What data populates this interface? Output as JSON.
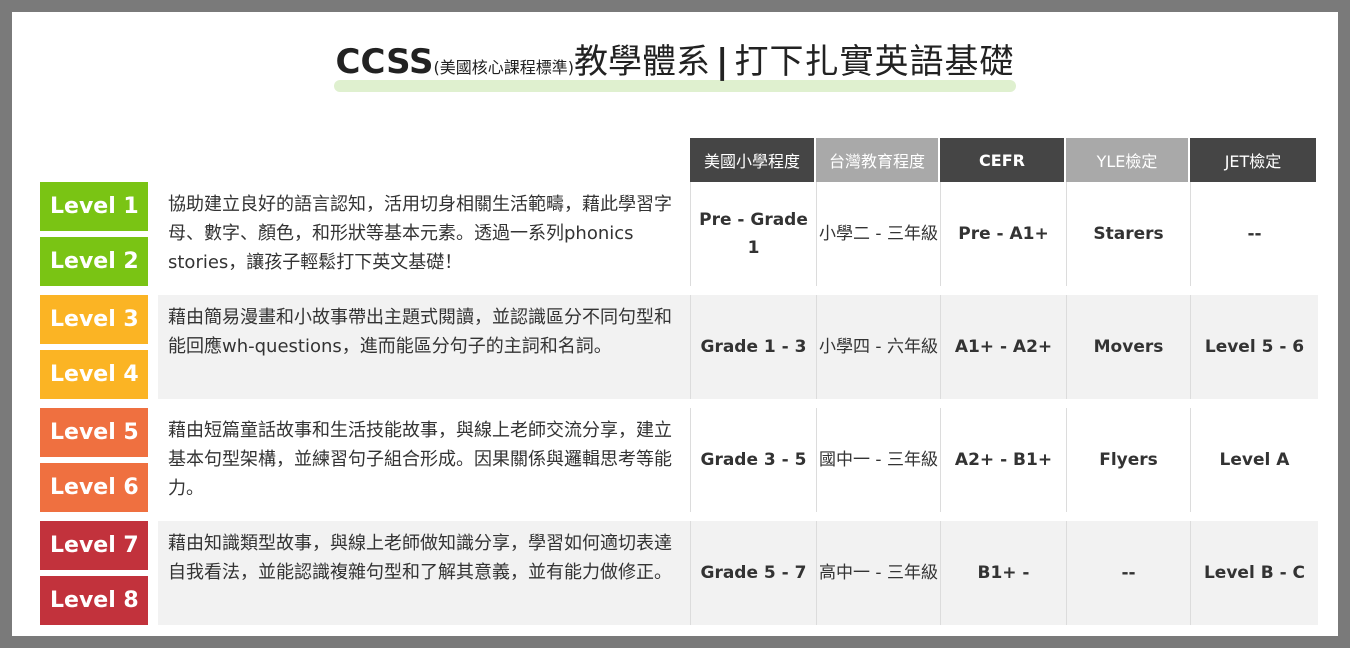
{
  "title": {
    "main": "CCSS",
    "sub": "(美國核心課程標準)",
    "system": "教學體系",
    "bar": "|",
    "tail": "打下扎實英語基礎"
  },
  "headers": [
    "美國小學程度",
    "台灣教育程度",
    "CEFR",
    "YLE檢定",
    "JET檢定"
  ],
  "colors": {
    "l12": "#7ac414",
    "l34": "#fbb424",
    "l56": "#ef7040",
    "l78": "#c2323c",
    "header_dark": "#454545",
    "header_light": "#a9a9a9"
  },
  "rows": [
    {
      "level_a": "Level 1",
      "level_b": "Level 2",
      "desc": "協助建立良好的語言認知，活用切身相關生活範疇，藉此學習字母、數字、顏色，和形狀等基本元素。透過一系列phonics stories，讓孩子輕鬆打下英文基礎！",
      "us": "Pre - Grade 1",
      "tw": "小學二 - 三年級",
      "cefr": "Pre - A1+",
      "yle": "Starers",
      "jet": "--"
    },
    {
      "level_a": "Level 3",
      "level_b": "Level 4",
      "desc": "藉由簡易漫畫和小故事帶出主題式閱讀，並認識區分不同句型和能回應wh-questions，進而能區分句子的主詞和名詞。",
      "us": "Grade 1 - 3",
      "tw": "小學四 - 六年級",
      "cefr": "A1+ - A2+",
      "yle": "Movers",
      "jet": "Level 5 - 6"
    },
    {
      "level_a": "Level 5",
      "level_b": "Level 6",
      "desc": "藉由短篇童話故事和生活技能故事，與線上老師交流分享，建立基本句型架構，並練習句子組合形成。因果關係與邏輯思考等能力。",
      "us": "Grade 3 - 5",
      "tw": "國中一 - 三年級",
      "cefr": "A2+ - B1+",
      "yle": "Flyers",
      "jet": "Level A"
    },
    {
      "level_a": "Level 7",
      "level_b": "Level 8",
      "desc": "藉由知識類型故事，與線上老師做知識分享，學習如何適切表達自我看法，並能認識複雜句型和了解其意義，並有能力做修正。",
      "us": "Grade 5 - 7",
      "tw": "高中一 - 三年級",
      "cefr": "B1+ -",
      "yle": "--",
      "jet": "Level B - C"
    }
  ]
}
